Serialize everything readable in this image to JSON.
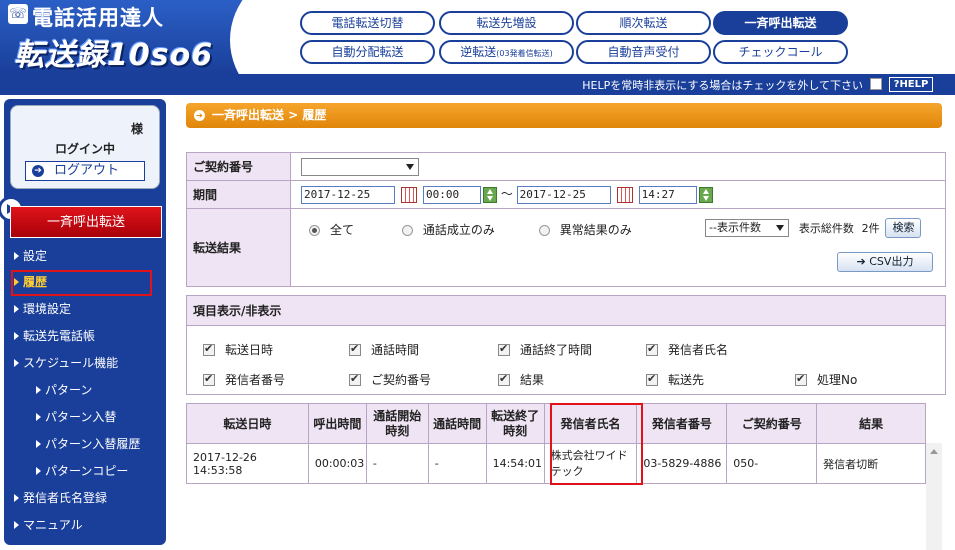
{
  "app": {
    "title_top": "電話活用達人",
    "title_main": "転送録10so6",
    "phone_icon": "phone-icon"
  },
  "nav": {
    "row1": [
      "電話転送切替",
      "転送先増設",
      "順次転送",
      "一斉呼出転送"
    ],
    "row2": [
      "自動分配転送",
      "逆転送",
      "(03発着信転送)",
      "自動音声受付",
      "チェックコール"
    ],
    "active": "一斉呼出転送"
  },
  "helpbar": {
    "text": "HELPを常時非表示にする場合はチェックを外して下さい",
    "button": "?HELP"
  },
  "sidebar": {
    "sama": "様",
    "login_status": "ログイン中",
    "logout": "ログアウト",
    "section_title": "一斉呼出転送",
    "items": [
      "設定",
      "履歴",
      "環境設定",
      "転送先電話帳",
      "スケジュール機能",
      "パターン",
      "パターン入替",
      "パターン入替履歴",
      "パターンコピー",
      "発信者氏名登録",
      "マニュアル"
    ],
    "active": "履歴"
  },
  "breadcrumb": "一斉呼出転送 > 履歴",
  "form": {
    "contract_label": "ご契約番号",
    "period_label": "期間",
    "date_from": "2017-12-25",
    "time_from": "00:00",
    "tilde": "〜",
    "date_to": "2017-12-25",
    "time_to": "14:27",
    "result_label": "転送結果",
    "radio_all": "全て",
    "radio_success": "通話成立のみ",
    "radio_error": "異常結果のみ",
    "count_select": "--表示件数",
    "total_label": "表示総件数",
    "total_value": "2件",
    "search_button": "検索",
    "csv_button": "CSV出力"
  },
  "items": {
    "head": "項目表示/非表示",
    "row1": [
      "転送日時",
      "通話時間",
      "通話終了時間",
      "発信者氏名"
    ],
    "row2": [
      "発信者番号",
      "ご契約番号",
      "結果",
      "転送先",
      "処理No"
    ]
  },
  "results": {
    "headers": [
      "転送日時",
      "呼出時間",
      "通話開始\n時刻",
      "通話時間",
      "転送終了\n時刻",
      "発信者氏名",
      "発信者番号",
      "ご契約番号",
      "結果"
    ],
    "rows": [
      [
        "2017-12-26 14:53:58",
        "00:00:03",
        "-",
        "-",
        "14:54:01",
        "株式会社ワイドテック",
        "03-5829-4886",
        "050-",
        "発信者切断"
      ]
    ]
  }
}
